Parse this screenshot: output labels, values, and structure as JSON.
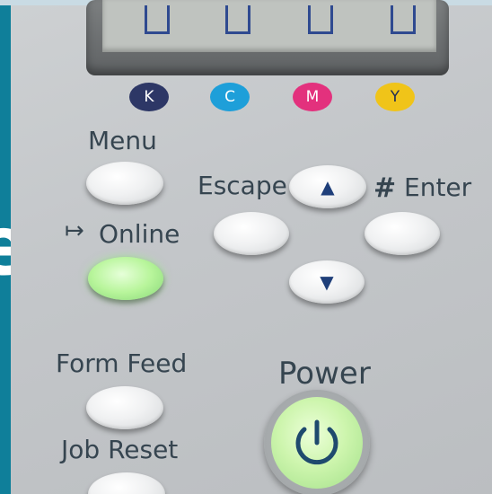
{
  "toner_indicators": [
    {
      "letter": "K",
      "color": "#2d3766"
    },
    {
      "letter": "C",
      "color": "#1e9fd9"
    },
    {
      "letter": "M",
      "color": "#e3317d"
    },
    {
      "letter": "Y",
      "color": "#f0c419"
    }
  ],
  "labels": {
    "menu": "Menu",
    "escape": "Escape",
    "enter_symbol": "#",
    "enter": "Enter",
    "online_symbol": "↦",
    "online": "Online",
    "form_feed": "Form Feed",
    "job_reset": "Job Reset",
    "power": "Power"
  },
  "glyphs": {
    "up_arrow": "▲",
    "down_arrow": "▼",
    "power_symbol": "⏻",
    "side_letter": "e"
  },
  "colors": {
    "panel": "#c6c9cc",
    "label_text": "#364550",
    "online_led": "#b8f59b",
    "power_led": "#cdf5ad",
    "side_band": "#0f7f9a"
  }
}
